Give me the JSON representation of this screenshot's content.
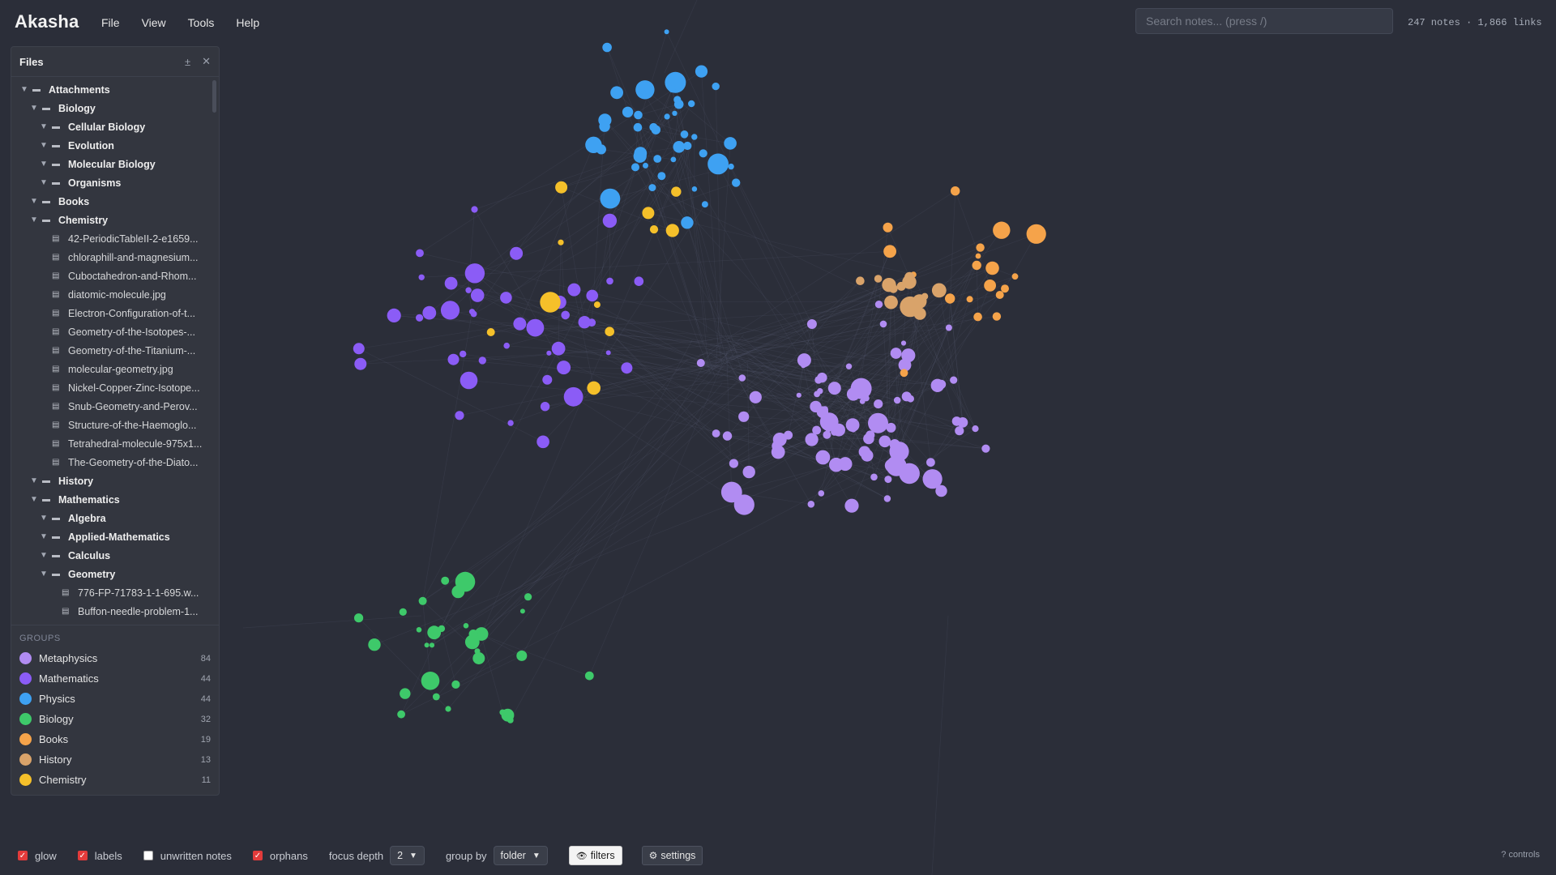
{
  "app": {
    "name": "Akasha"
  },
  "menu": {
    "items": [
      "File",
      "View",
      "Tools",
      "Help"
    ]
  },
  "search": {
    "placeholder": "Search notes... (press /)"
  },
  "stats": {
    "text": "247 notes · 1,866 links"
  },
  "files_panel": {
    "title": "Files",
    "collapse_glyph": "±",
    "close_glyph": "✕",
    "tree": [
      {
        "label": "Attachments",
        "type": "folder",
        "depth": 0
      },
      {
        "label": "Biology",
        "type": "folder",
        "depth": 1
      },
      {
        "label": "Cellular Biology",
        "type": "folder",
        "depth": 2
      },
      {
        "label": "Evolution",
        "type": "folder",
        "depth": 2
      },
      {
        "label": "Molecular Biology",
        "type": "folder",
        "depth": 2
      },
      {
        "label": "Organisms",
        "type": "folder",
        "depth": 2
      },
      {
        "label": "Books",
        "type": "folder",
        "depth": 1
      },
      {
        "label": "Chemistry",
        "type": "folder",
        "depth": 1
      },
      {
        "label": "42-PeriodicTableII-2-e1659...",
        "type": "file",
        "depth": 2
      },
      {
        "label": "chloraphill-and-magnesium...",
        "type": "file",
        "depth": 2
      },
      {
        "label": "Cuboctahedron-and-Rhom...",
        "type": "file",
        "depth": 2
      },
      {
        "label": "diatomic-molecule.jpg",
        "type": "file",
        "depth": 2
      },
      {
        "label": "Electron-Configuration-of-t...",
        "type": "file",
        "depth": 2
      },
      {
        "label": "Geometry-of-the-Isotopes-...",
        "type": "file",
        "depth": 2
      },
      {
        "label": "Geometry-of-the-Titanium-...",
        "type": "file",
        "depth": 2
      },
      {
        "label": "molecular-geometry.jpg",
        "type": "file",
        "depth": 2
      },
      {
        "label": "Nickel-Copper-Zinc-Isotope...",
        "type": "file",
        "depth": 2
      },
      {
        "label": "Snub-Geometry-and-Perov...",
        "type": "file",
        "depth": 2
      },
      {
        "label": "Structure-of-the-Haemoglo...",
        "type": "file",
        "depth": 2
      },
      {
        "label": "Tetrahedral-molecule-975x1...",
        "type": "file",
        "depth": 2
      },
      {
        "label": "The-Geometry-of-the-Diato...",
        "type": "file",
        "depth": 2
      },
      {
        "label": "History",
        "type": "folder",
        "depth": 1
      },
      {
        "label": "Mathematics",
        "type": "folder",
        "depth": 1
      },
      {
        "label": "Algebra",
        "type": "folder",
        "depth": 2
      },
      {
        "label": "Applied-Mathematics",
        "type": "folder",
        "depth": 2
      },
      {
        "label": "Calculus",
        "type": "folder",
        "depth": 2
      },
      {
        "label": "Geometry",
        "type": "folder",
        "depth": 2
      },
      {
        "label": "776-FP-71783-1-1-695.w...",
        "type": "file",
        "depth": 3
      },
      {
        "label": "Buffon-needle-problem-1...",
        "type": "file",
        "depth": 3
      }
    ]
  },
  "groups": {
    "title": "GROUPS",
    "items": [
      {
        "name": "Metaphysics",
        "count": "84",
        "color": "#b18cf2"
      },
      {
        "name": "Mathematics",
        "count": "44",
        "color": "#8b5cf6"
      },
      {
        "name": "Physics",
        "count": "44",
        "color": "#3ea1f2"
      },
      {
        "name": "Biology",
        "count": "32",
        "color": "#3ec96a"
      },
      {
        "name": "Books",
        "count": "19",
        "color": "#f5a34a"
      },
      {
        "name": "History",
        "count": "13",
        "color": "#d9a36a"
      },
      {
        "name": "Chemistry",
        "count": "11",
        "color": "#f5c02a"
      }
    ]
  },
  "bottom_bar": {
    "glow": {
      "label": "glow",
      "checked": true
    },
    "labels": {
      "label": "labels",
      "checked": true
    },
    "unwritten": {
      "label": "unwritten notes",
      "checked": false
    },
    "orphans": {
      "label": "orphans",
      "checked": true
    },
    "focus_depth": {
      "label": "focus depth",
      "value": "2"
    },
    "group_by": {
      "label": "group by",
      "value": "folder"
    },
    "filters_label": "filters",
    "settings_label": "settings",
    "controls_link": "? controls"
  }
}
